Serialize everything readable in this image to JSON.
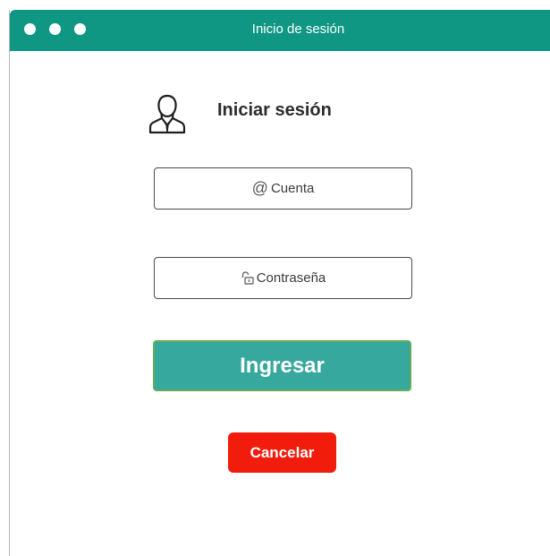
{
  "window": {
    "title": "Inicio de sesión",
    "titlebar_color": "#0f9784"
  },
  "login": {
    "heading": "Iniciar sesión",
    "user_icon": "user-icon",
    "account_field": {
      "icon": "at-icon",
      "placeholder": "Cuenta"
    },
    "password_field": {
      "icon": "unlock-icon",
      "placeholder": "Contraseña"
    },
    "submit_label": "Ingresar",
    "submit_color": "#36a89d",
    "cancel_label": "Cancelar",
    "cancel_color": "#f11c0c"
  }
}
